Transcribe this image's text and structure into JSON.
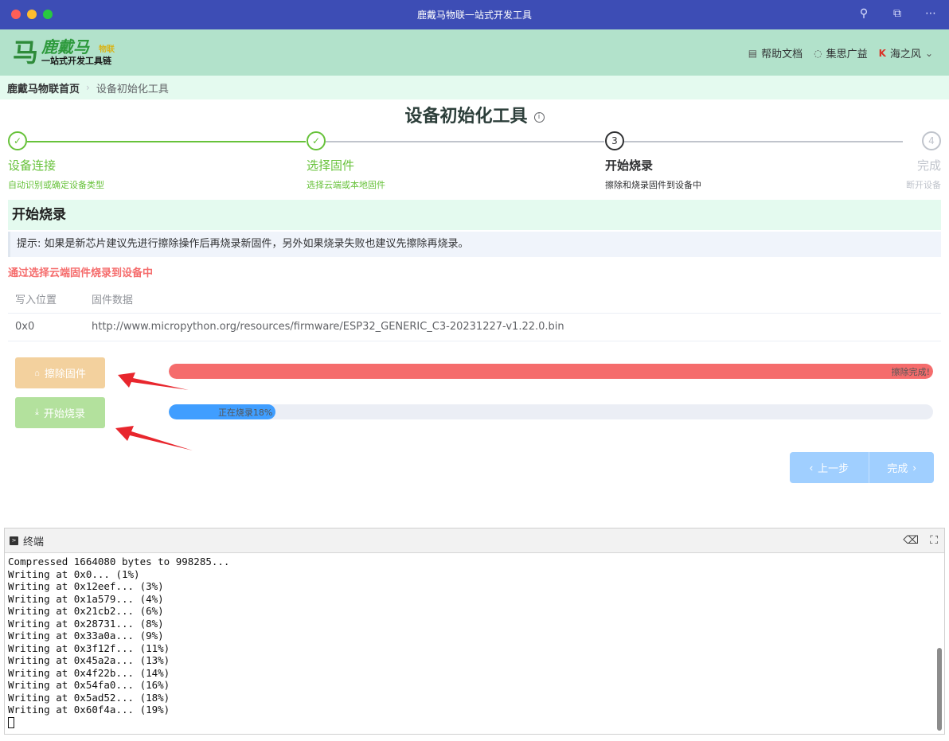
{
  "window": {
    "title": "鹿戴马物联一站式开发工具"
  },
  "brand": {
    "name": "鹿戴马",
    "badge": "物联",
    "tagline": "一站式开发工具链"
  },
  "header": {
    "links": [
      {
        "label": "帮助文档"
      },
      {
        "label": "集思广益"
      },
      {
        "label": "海之风"
      }
    ]
  },
  "breadcrumb": {
    "home": "鹿戴马物联首页",
    "current": "设备初始化工具"
  },
  "page": {
    "title": "设备初始化工具"
  },
  "steps": [
    {
      "title": "设备连接",
      "desc": "自动识别或确定设备类型",
      "status": "done",
      "number": "✓"
    },
    {
      "title": "选择固件",
      "desc": "选择云端或本地固件",
      "status": "done",
      "number": "✓"
    },
    {
      "title": "开始烧录",
      "desc": "擦除和烧录固件到设备中",
      "status": "active",
      "number": "3"
    },
    {
      "title": "完成",
      "desc": "断开设备",
      "status": "wait",
      "number": "4"
    }
  ],
  "section": {
    "title": "开始烧录",
    "tip": "提示: 如果是新芯片建议先进行擦除操作后再烧录新固件，另外如果烧录失败也建议先擦除再烧录。",
    "source_note": "通过选择云端固件烧录到设备中"
  },
  "firmware_table": {
    "headers": [
      "写入位置",
      "固件数据"
    ],
    "rows": [
      [
        "0x0",
        "http://www.micropython.org/resources/firmware/ESP32_GENERIC_C3-20231227-v1.22.0.bin"
      ]
    ]
  },
  "actions": {
    "erase": {
      "label": "擦除固件",
      "progress_text": "擦除完成!",
      "percent": 100
    },
    "flash": {
      "label": "开始烧录",
      "progress_text": "正在烧录18%",
      "percent": 14
    }
  },
  "nav": {
    "prev_label": "上一步",
    "done_label": "完成"
  },
  "terminal": {
    "title": "终端",
    "lines": [
      "Compressed 1664080 bytes to 998285...",
      "Writing at 0x0... (1%)",
      "Writing at 0x12eef... (3%)",
      "Writing at 0x1a579... (4%)",
      "Writing at 0x21cb2... (6%)",
      "Writing at 0x28731... (8%)",
      "Writing at 0x33a0a... (9%)",
      "Writing at 0x3f12f... (11%)",
      "Writing at 0x45a2a... (13%)",
      "Writing at 0x4f22b... (14%)",
      "Writing at 0x54fa0... (16%)",
      "Writing at 0x5ad52... (18%)",
      "Writing at 0x60f4a... (19%)"
    ]
  },
  "colors": {
    "titlebar": "#3d4db5",
    "header": "#b2e2cb",
    "success": "#67c23a",
    "danger": "#f56c6c",
    "primary": "#409eff"
  },
  "icons": [
    "key-icon",
    "screen-icon",
    "more-icon",
    "book-icon",
    "chat-icon",
    "user-logo-icon",
    "chevron-down-icon",
    "info-icon",
    "check-icon",
    "broom-icon",
    "download-icon",
    "chevron-left-icon",
    "chevron-right-icon",
    "terminal-icon",
    "clear-icon",
    "fullscreen-icon"
  ]
}
